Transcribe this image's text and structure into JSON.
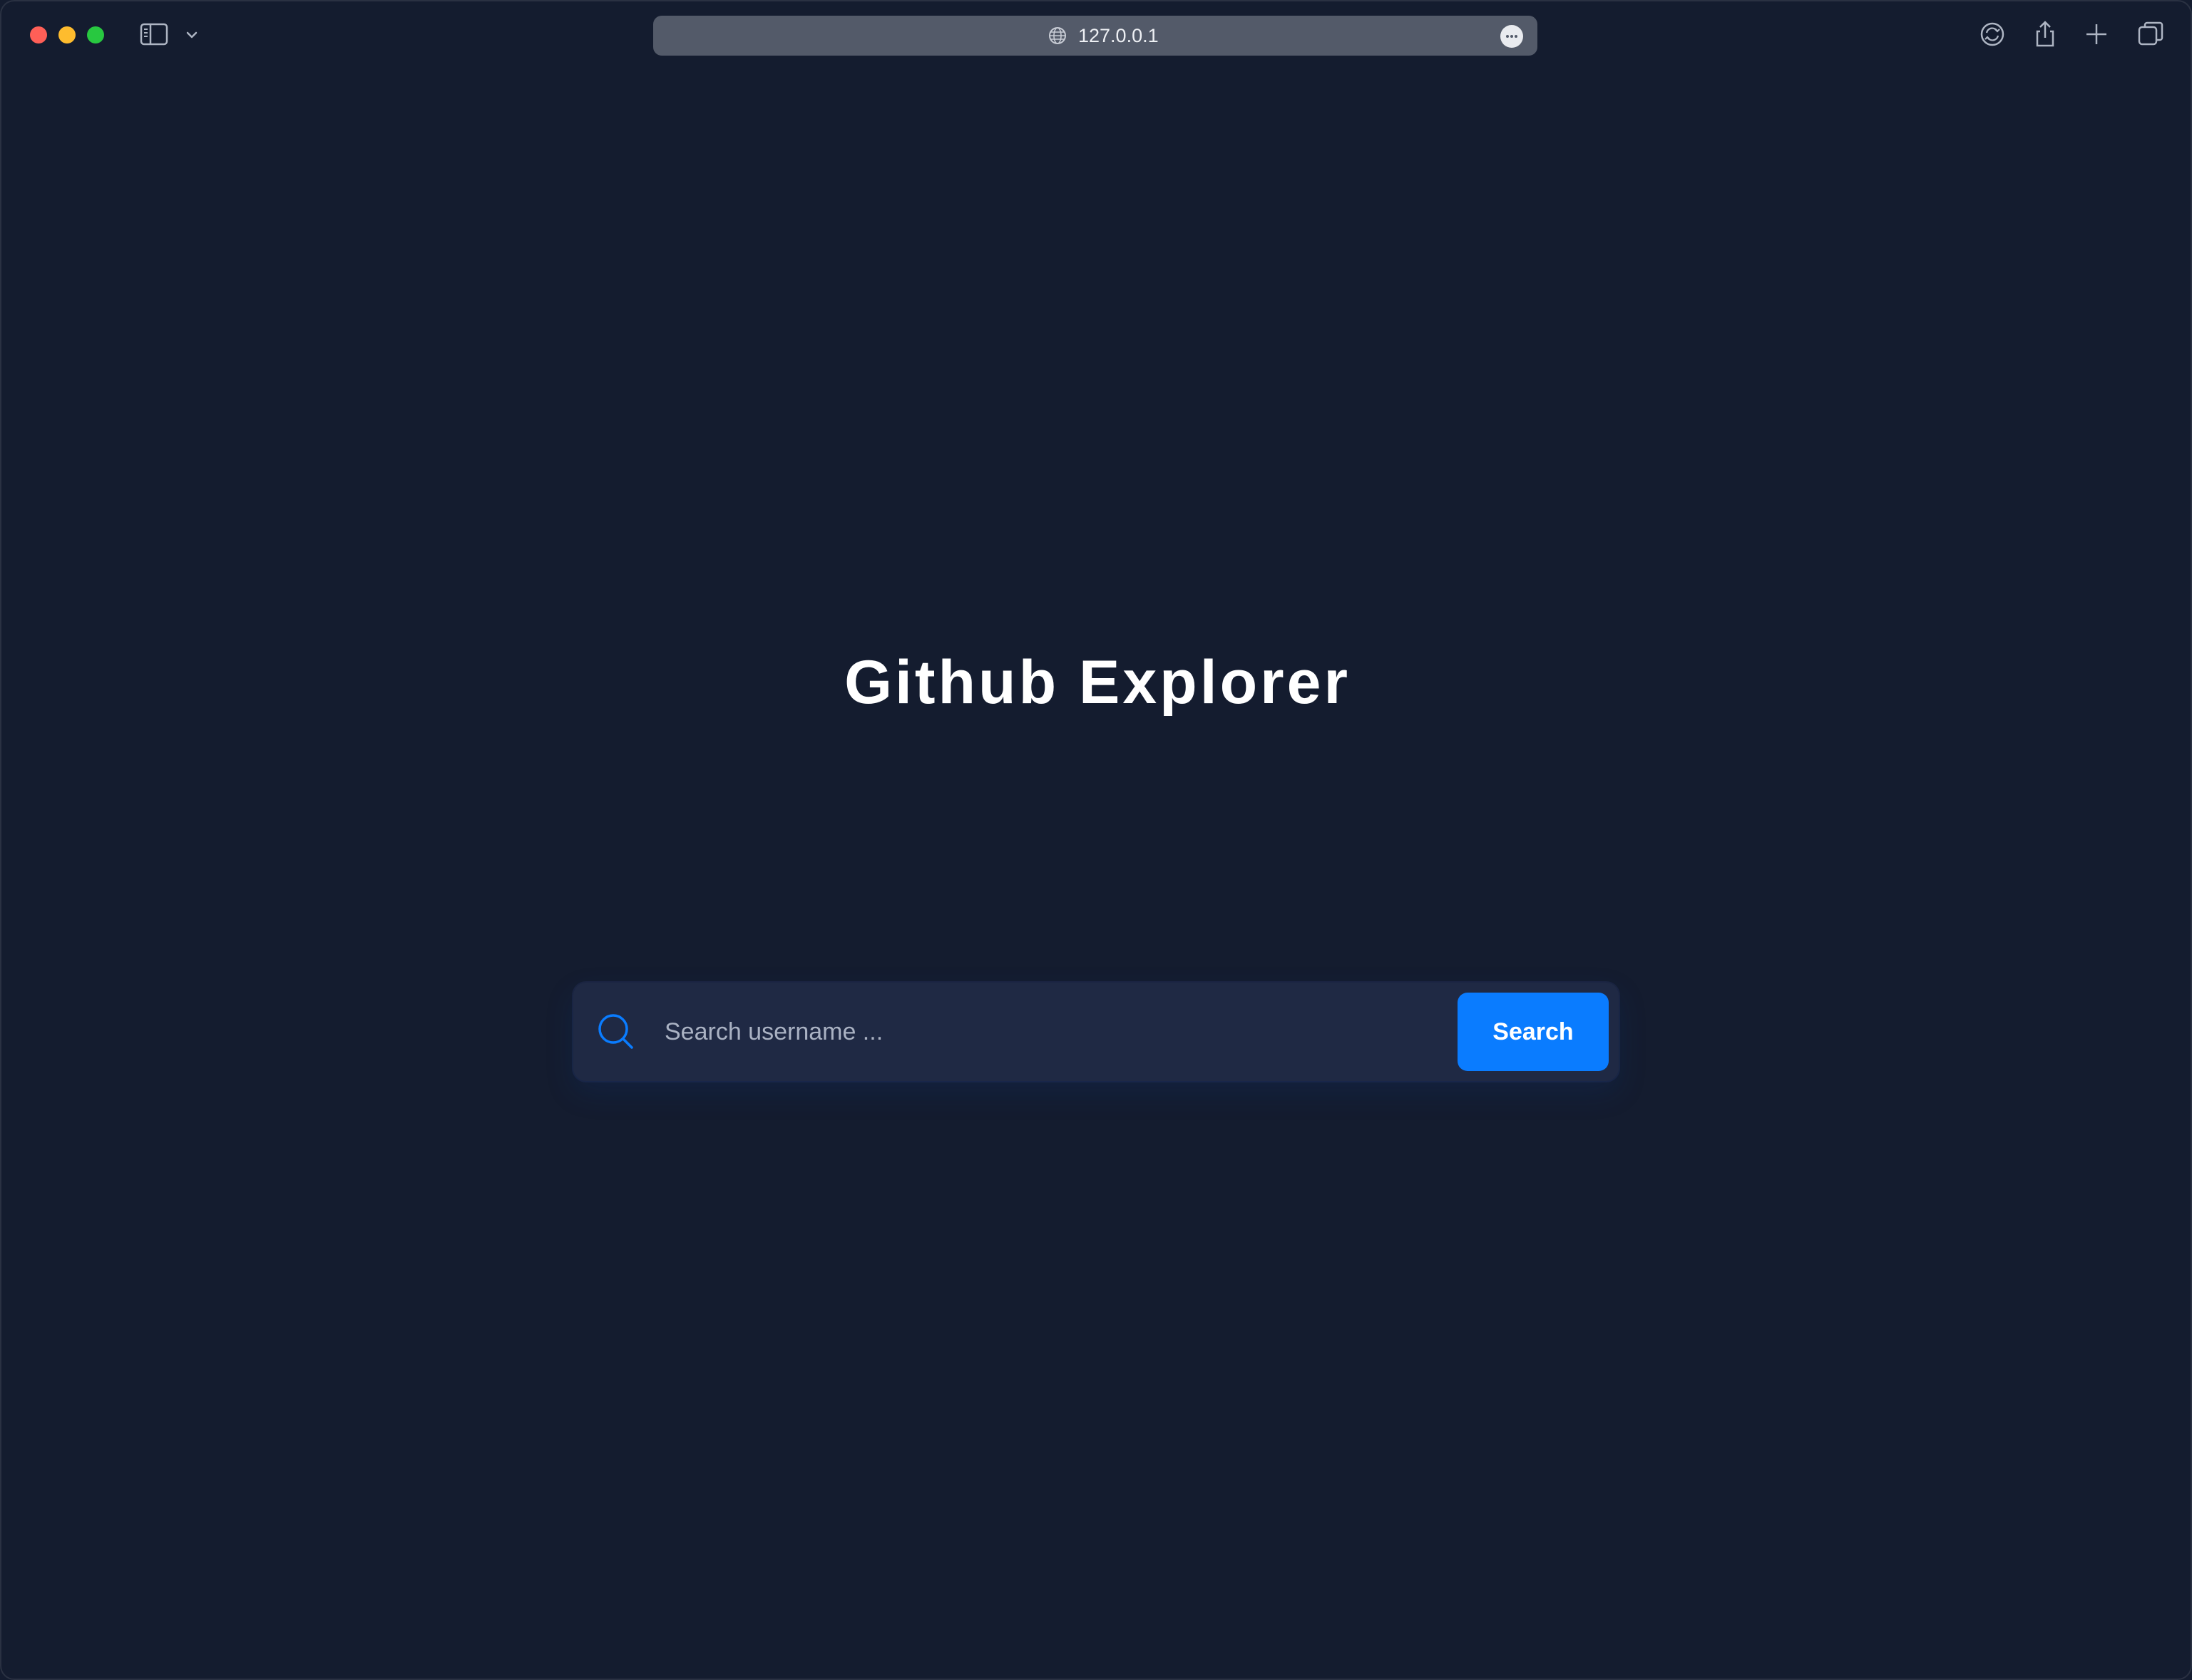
{
  "browser": {
    "address": "127.0.0.1",
    "icons": {
      "sidebar": "sidebar-icon",
      "chevron": "chevron-down-icon",
      "globe": "globe-icon",
      "more": "more-icon",
      "reload": "reload-icon",
      "share": "share-icon",
      "new_tab": "plus-icon",
      "tabs": "tabs-overview-icon"
    }
  },
  "main": {
    "title": "Github Explorer",
    "search": {
      "placeholder": "Search username ...",
      "value": "",
      "button_label": "Search",
      "icon": "search-icon"
    }
  },
  "colors": {
    "background": "#141c2f",
    "search_box": "#1f2944",
    "accent": "#0a7cff",
    "title": "#ffffff"
  }
}
